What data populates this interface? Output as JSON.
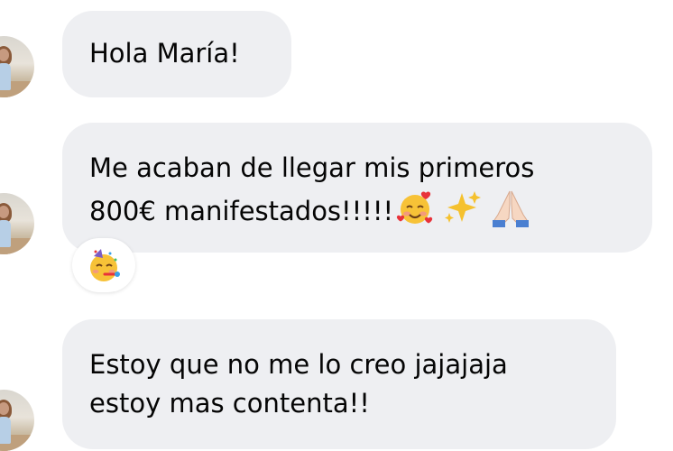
{
  "messages": [
    {
      "lines": [
        "Hola María!"
      ]
    },
    {
      "lines": [
        "Me acaban de llegar mis primeros",
        "800€ manifestados!!!!!"
      ],
      "trailing_emojis": [
        "smiling-face-with-hearts",
        "sparkles",
        "folded-hands"
      ]
    },
    {
      "lines": [
        "Estoy que no me lo creo jajajaja",
        "estoy mas contenta!!"
      ]
    }
  ],
  "reaction": {
    "emoji": "partying-face"
  },
  "colors": {
    "bubble": "#eeeff2",
    "text": "#050505",
    "background": "#ffffff"
  }
}
